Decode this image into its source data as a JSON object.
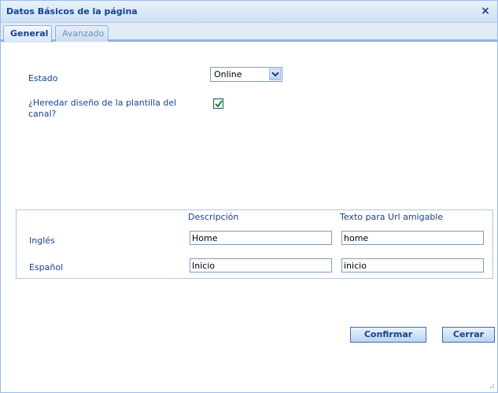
{
  "dialog": {
    "title": "Datos Básicos de la página",
    "close_label": "×"
  },
  "tabs": [
    {
      "label": "General",
      "active": true
    },
    {
      "label": "Avanzado",
      "active": false
    }
  ],
  "form": {
    "estado_label": "Estado",
    "estado_value": "Online",
    "heredar_label_line1": "¿Heredar diseño de la plantilla del",
    "heredar_label_line2": "canal?",
    "heredar_checked": true
  },
  "languages": {
    "col_descripcion": "Descripción",
    "col_url": "Texto para Url amigable",
    "rows": [
      {
        "language": "Inglés",
        "descripcion": "Home",
        "url": "home"
      },
      {
        "language": "Español",
        "descripcion": "Inicio",
        "url": "inicio"
      }
    ]
  },
  "buttons": {
    "confirm_label": "Confirmar",
    "close_label": "Cerrar"
  },
  "colors": {
    "accent": "#15428b",
    "border": "#99bbe8",
    "check": "#1e8a1e"
  }
}
